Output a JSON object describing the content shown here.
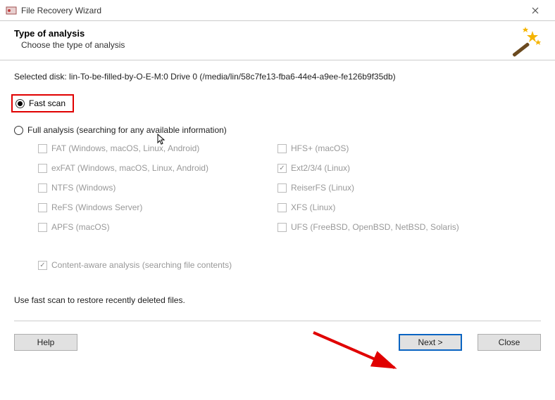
{
  "window": {
    "title": "File Recovery Wizard"
  },
  "header": {
    "title": "Type of analysis",
    "subtitle": "Choose the type of analysis"
  },
  "selected_disk_label": "Selected disk: lin-To-be-filled-by-O-E-M:0 Drive 0 (/media/lin/58c7fe13-fba6-44e4-a9ee-fe126b9f35db)",
  "options": {
    "fast_scan": "Fast scan",
    "full_analysis": "Full analysis (searching for any available information)"
  },
  "filesystems": {
    "left": [
      "FAT (Windows, macOS, Linux, Android)",
      "exFAT (Windows, macOS, Linux, Android)",
      "NTFS (Windows)",
      "ReFS (Windows Server)",
      "APFS (macOS)"
    ],
    "right": [
      "HFS+ (macOS)",
      "Ext2/3/4 (Linux)",
      "ReiserFS (Linux)",
      "XFS (Linux)",
      "UFS (FreeBSD, OpenBSD, NetBSD, Solaris)"
    ],
    "checked_right_index": 1
  },
  "content_aware": "Content-aware analysis (searching file contents)",
  "hint": "Use fast scan to restore recently deleted files.",
  "buttons": {
    "help": "Help",
    "next": "Next >",
    "close": "Close"
  }
}
